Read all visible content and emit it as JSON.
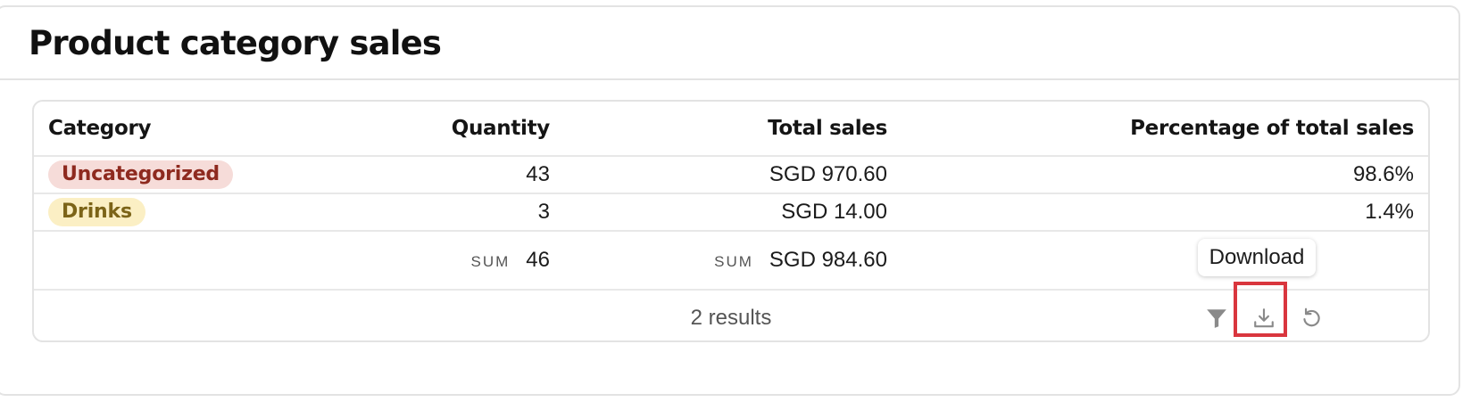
{
  "panel": {
    "title": "Product category sales"
  },
  "table": {
    "columns": [
      "Category",
      "Quantity",
      "Total sales",
      "Percentage of total sales"
    ],
    "rows": [
      {
        "category": "Uncategorized",
        "badge_bg": "#f6dcd9",
        "badge_fg": "#8e2a1f",
        "quantity": "43",
        "total_sales": "SGD 970.60",
        "percentage": "98.6%"
      },
      {
        "category": "Drinks",
        "badge_bg": "#fbefc4",
        "badge_fg": "#7c6418",
        "quantity": "3",
        "total_sales": "SGD 14.00",
        "percentage": "1.4%"
      }
    ],
    "summary": {
      "quantity_label": "SUM",
      "quantity_value": "46",
      "total_label": "SUM",
      "total_value": "SGD 984.60"
    }
  },
  "footer": {
    "results": "2 results",
    "icons": [
      "filter-icon",
      "download-icon",
      "reset-icon"
    ]
  },
  "tooltip": {
    "text": "Download"
  },
  "colors": {
    "highlight": "#d9363e",
    "icon": "#8a8a8a",
    "border": "#e3e3e3"
  }
}
